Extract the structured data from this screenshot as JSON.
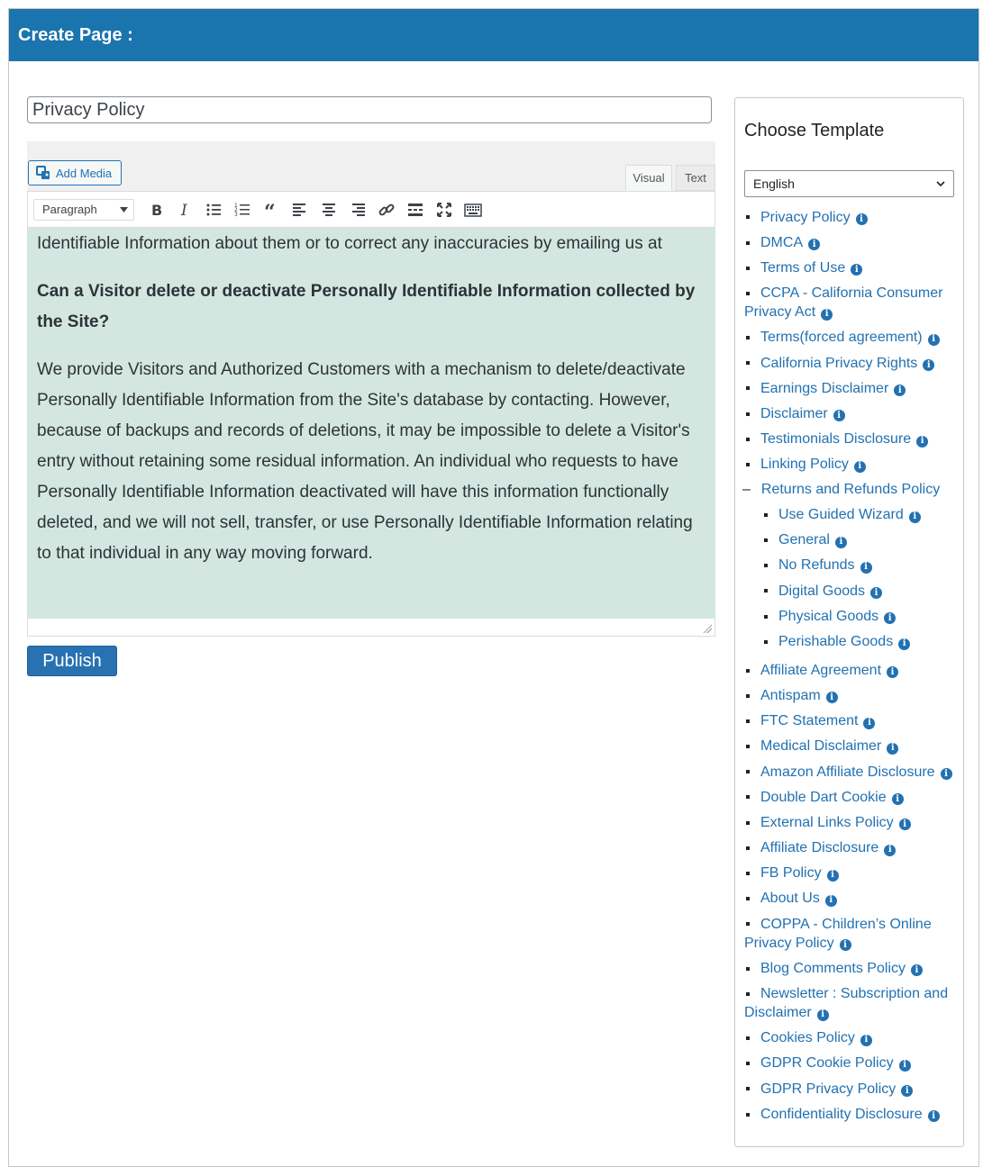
{
  "header": {
    "title": "Create Page :"
  },
  "title_field": {
    "value": "Privacy Policy"
  },
  "editor": {
    "add_media_label": "Add Media",
    "tabs": [
      {
        "label": "Visual"
      },
      {
        "label": "Text"
      }
    ],
    "format_select": "Paragraph",
    "toolbar_icons": [
      "bold-icon",
      "italic-icon",
      "bullet-list-icon",
      "numbered-list-icon",
      "blockquote-icon",
      "align-left-icon",
      "align-center-icon",
      "align-right-icon",
      "link-icon",
      "read-more-icon",
      "fullscreen-icon",
      "toolbar-toggle-icon"
    ],
    "content": {
      "lead": "Identifiable Information about them or to correct any inaccuracies by emailing us at",
      "question": "Can a Visitor delete or deactivate Personally Identifiable Information collected by the Site?",
      "answer": "We provide Visitors and Authorized Customers with a mechanism to delete/deactivate Personally Identifiable Information from the Site's database by contacting. However, because of backups and records of deletions, it may be impossible to delete a Visitor's entry without retaining some residual information. An individual who requests to have Personally Identifiable Information deactivated will have this information functionally deleted, and we will not sell, transfer, or use Personally Identifiable Information relating to that individual in any way moving forward."
    }
  },
  "publish_label": "Publish",
  "sidebar": {
    "title": "Choose Template",
    "language": "English",
    "templates": [
      {
        "label": "Privacy Policy"
      },
      {
        "label": "DMCA"
      },
      {
        "label": "Terms of Use"
      },
      {
        "label": "CCPA - California Consumer Privacy Act"
      },
      {
        "label": "Terms(forced agreement)"
      },
      {
        "label": "California Privacy Rights"
      },
      {
        "label": "Earnings Disclaimer"
      },
      {
        "label": "Disclaimer"
      },
      {
        "label": "Testimonials Disclosure"
      },
      {
        "label": "Linking Policy"
      },
      {
        "label": "Returns and Refunds Policy"
      },
      {
        "label": "Affiliate Agreement"
      },
      {
        "label": "Antispam"
      },
      {
        "label": "FTC Statement"
      },
      {
        "label": "Medical Disclaimer"
      },
      {
        "label": "Amazon Affiliate Disclosure"
      },
      {
        "label": "Double Dart Cookie"
      },
      {
        "label": "External Links Policy"
      },
      {
        "label": "Affiliate Disclosure"
      },
      {
        "label": "FB Policy"
      },
      {
        "label": "About Us"
      },
      {
        "label": "COPPA - Children’s Online Privacy Policy"
      },
      {
        "label": "Blog Comments Policy"
      },
      {
        "label": "Newsletter : Subscription and Disclaimer"
      },
      {
        "label": "Cookies Policy"
      },
      {
        "label": "GDPR Cookie Policy"
      },
      {
        "label": "GDPR Privacy Policy"
      },
      {
        "label": "Confidentiality Disclosure"
      }
    ],
    "refund_subitems": [
      {
        "label": "Use Guided Wizard"
      },
      {
        "label": "General"
      },
      {
        "label": "No Refunds"
      },
      {
        "label": "Digital Goods"
      },
      {
        "label": "Physical Goods"
      },
      {
        "label": "Perishable Goods"
      }
    ],
    "info_glyph": "i"
  }
}
